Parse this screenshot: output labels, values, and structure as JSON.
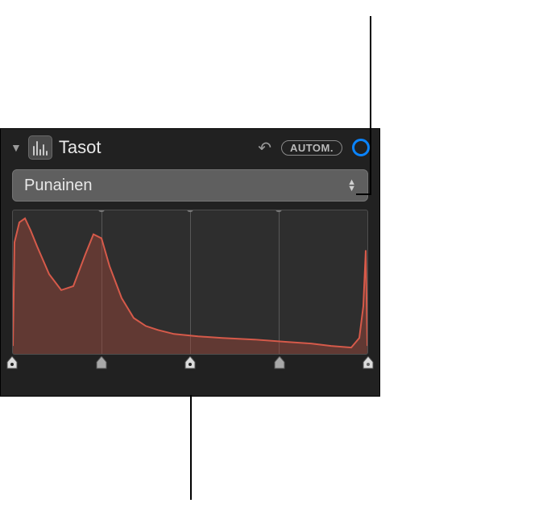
{
  "header": {
    "title": "Tasot",
    "auto_label": "AUTOM."
  },
  "channel": {
    "selected": "Punainen"
  },
  "histogram": {
    "color_stroke": "#d65a4a",
    "color_fill": "rgba(160,70,58,0.45)",
    "grid_positions_pct": [
      25,
      50,
      75
    ],
    "slider_positions_pct": [
      0,
      25,
      50,
      75,
      100
    ]
  }
}
